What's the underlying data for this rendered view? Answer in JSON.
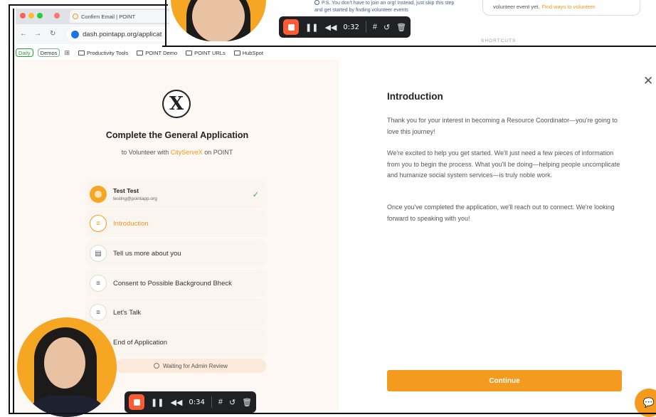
{
  "browser": {
    "tab_title": "Confirm Email | POINT",
    "url": "dash.pointapp.org/applicat",
    "bookmarks": {
      "pills": [
        "Daily",
        "Demos"
      ],
      "folders": [
        "Productivity Tools",
        "POINT Demo",
        "POINT URLs",
        "HubSpot"
      ]
    }
  },
  "background_page": {
    "ps_note": "P.S. You don't have to join an org! Instead, just skip this step and get started by finding volunteer events",
    "volunteer_box_text": "volunteer event yet.",
    "volunteer_box_link": "Find ways to volunteer.",
    "shortcuts_heading": "SHORTCUTS"
  },
  "recorder_top": {
    "time": "0:32"
  },
  "recorder_bottom": {
    "time": "0:34"
  },
  "application": {
    "title": "Complete the General Application",
    "subtitle_prefix": "to Volunteer with",
    "org_name": "CityServeX",
    "subtitle_suffix": "on POINT",
    "user": {
      "name": "Test Test",
      "email": "testing@pointapp.org"
    },
    "steps": [
      {
        "label": "Introduction",
        "icon": "lines-icon",
        "active": true
      },
      {
        "label": "Tell us more about you",
        "icon": "form-icon",
        "active": false
      },
      {
        "label": "Consent to Possible Background Bheck",
        "icon": "lines-icon",
        "active": false
      },
      {
        "label": "Let's Talk",
        "icon": "lines-icon",
        "active": false
      },
      {
        "label": "End of Application",
        "icon": "lines-icon",
        "active": false
      }
    ],
    "waiting_label": "Waiting for Admin Review"
  },
  "intro": {
    "title": "Introduction",
    "paragraphs": [
      "Thank you for your interest in becoming a Resource Coordinator—you're going to love this journey!",
      "We're excited to help you get started. We'll just need a few pieces of information from you to begin the process. What you'll be doing—helping people uncomplicate and humanize social system services—is truly noble work.",
      "Once you've completed the application, we'll reach out to connect. We're looking forward to speaking with you!"
    ],
    "continue_label": "Continue"
  },
  "colors": {
    "accent": "#f39a1f",
    "left_panel_bg": "#fdf8f3",
    "check": "#3aa55a",
    "recorder_bg": "#202124",
    "record_button": "#ff5a36"
  }
}
